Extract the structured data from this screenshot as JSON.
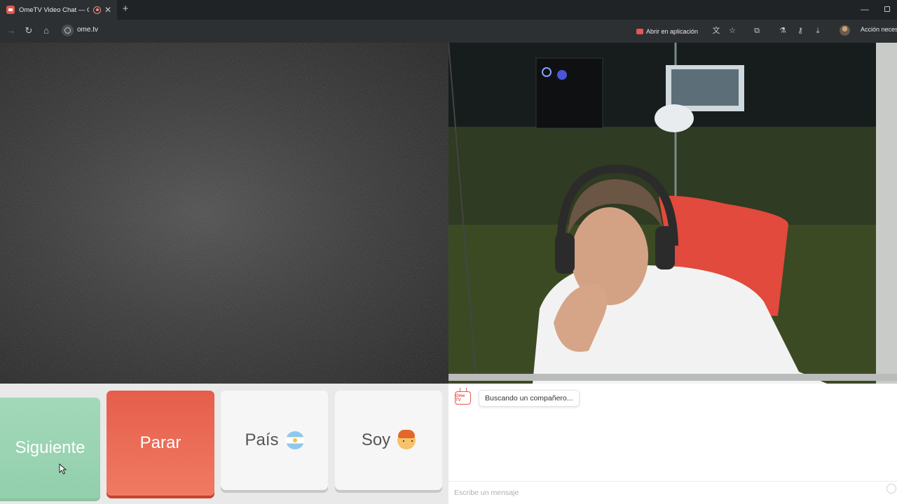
{
  "browser": {
    "tab_title": "OmeTV Video Chat — Omegle alternative",
    "url": "ome.tv",
    "open_in_app_label": "Abrir en aplicación",
    "action_label": "Acción necesaria"
  },
  "controls": {
    "next_label": "Siguiente",
    "stop_label": "Parar",
    "country_label": "País",
    "me_label": "Soy",
    "next_color": "#a2d9b9",
    "stop_color": "#e65e4b"
  },
  "chat": {
    "status_text": "Buscando un compañero...",
    "input_placeholder": "Escribe un mensaje",
    "logo_text": "Ome TV"
  },
  "icons": {
    "tab": [
      "ometv-favicon-icon",
      "recording-icon",
      "close-icon",
      "plus-icon"
    ],
    "nav": [
      "forward-icon",
      "reload-icon",
      "home-icon",
      "site-info-icon"
    ],
    "toolbar": [
      "open-in-app-icon",
      "translate-icon",
      "bookmark-star-icon",
      "extensions-icon",
      "performance-icon",
      "password-key-icon",
      "download-icon",
      "profile-icon"
    ],
    "chat": [
      "ometv-logo-icon",
      "emoji-icon"
    ]
  }
}
